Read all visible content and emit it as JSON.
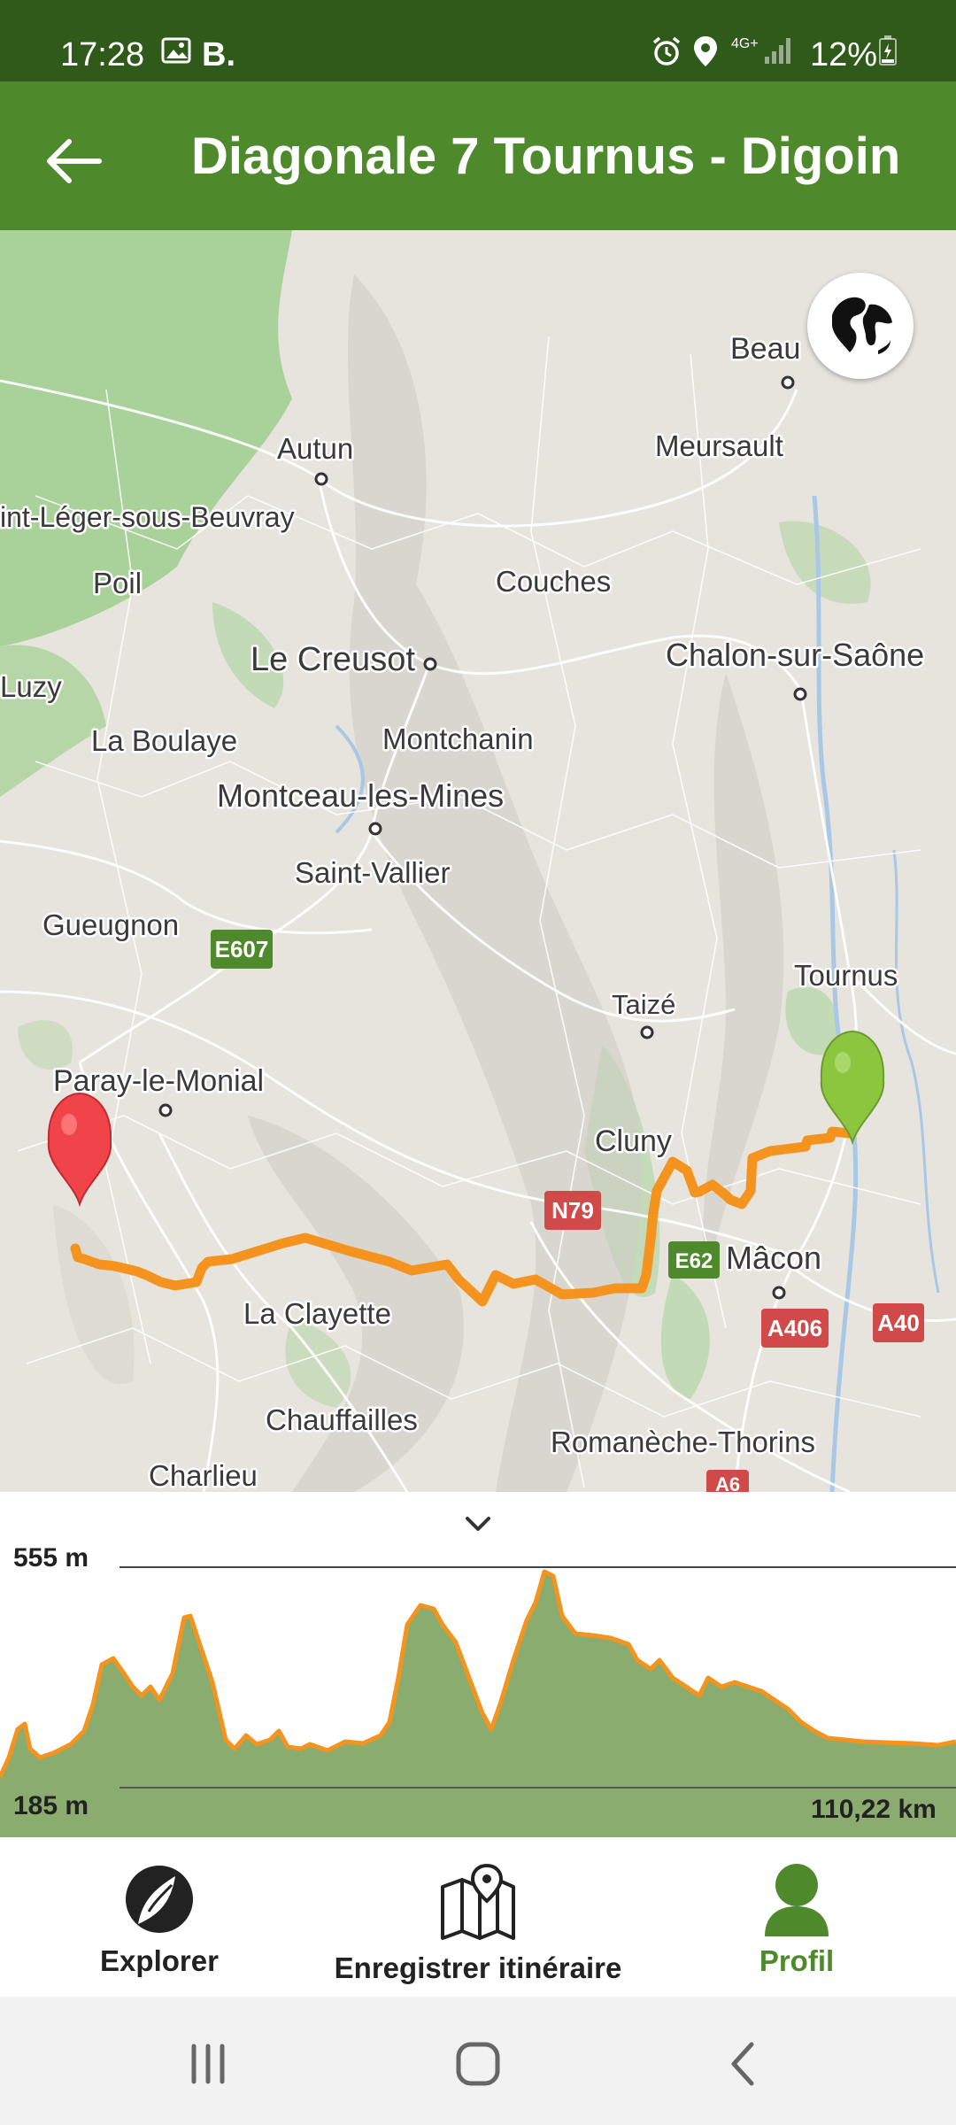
{
  "status_bar": {
    "time": "17:28",
    "carrier": "B.",
    "network": "4G+",
    "battery": "12%"
  },
  "app_bar": {
    "title": "Diagonale 7 Tournus - Digoin",
    "back_icon": "arrow-left-icon"
  },
  "map": {
    "places": {
      "beaune": "Beau",
      "autun": "Autun",
      "meursault": "Meursault",
      "saint_leger": "int-Léger-sous-Beuvray",
      "poil": "Poil",
      "couches": "Couches",
      "le_creusot": "Le Creusot",
      "chalon": "Chalon-sur-Saône",
      "luzy": "Luzy",
      "la_boulaye": "La Boulaye",
      "montchanin": "Montchanin",
      "montceau": "Montceau-les-Mines",
      "saint_vallier": "Saint-Vallier",
      "gueugnon": "Gueugnon",
      "tournus": "Tournus",
      "taize": "Taizé",
      "paray": "Paray-le-Monial",
      "cluny": "Cluny",
      "macon": "Mâcon",
      "la_clayette": "La Clayette",
      "chauffailles": "Chauffailles",
      "romaneche": "Romanèche-Thorins",
      "charlieu": "Charlieu"
    },
    "road_shields": {
      "e607": "E607",
      "n79": "N79",
      "e62": "E62",
      "a406": "A406",
      "a40": "A40",
      "a6": "A6"
    },
    "globe_icon": "globe-icon",
    "start_marker": "start-pin-icon",
    "end_marker": "end-pin-icon",
    "route_color": "#f4931e"
  },
  "elevation": {
    "max": "555 m",
    "min": "185 m",
    "distance": "110,22 km",
    "collapse_icon": "chevron-down-icon",
    "fill_color": "#8aac6e",
    "line_color": "#f4931e"
  },
  "bottom_nav": {
    "items": [
      {
        "label": "Explorer",
        "icon": "compass-icon",
        "active": false
      },
      {
        "label": "Enregistrer itinéraire",
        "icon": "map-pin-icon",
        "active": false
      },
      {
        "label": "Profil",
        "icon": "user-icon",
        "active": true
      }
    ],
    "active_color": "#4e8a2b"
  },
  "system_nav": {
    "recents_icon": "recents-icon",
    "home_icon": "home-icon",
    "back_icon": "back-chevron-icon"
  }
}
